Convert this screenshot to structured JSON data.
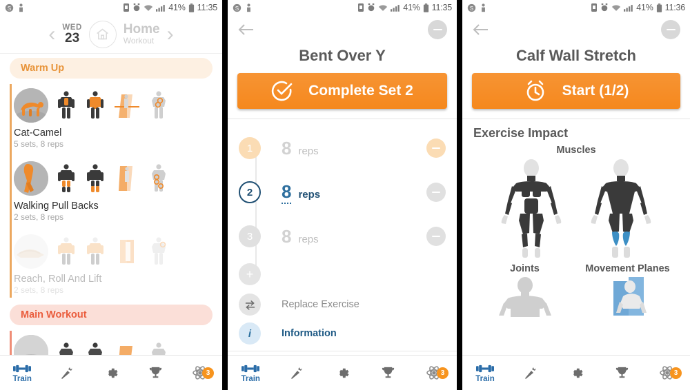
{
  "status_bar": {
    "left_icons": [
      "currency-circle-icon",
      "person-pin-icon"
    ],
    "right_icons": [
      "sim-card-icon",
      "alarm-icon",
      "wifi-icon",
      "signal-icon",
      "battery-icon"
    ],
    "battery_1": "41%",
    "time_1": "11:35",
    "battery_2": "41%",
    "time_2": "11:35",
    "battery_3": "41%",
    "time_3": "11:36"
  },
  "colors": {
    "accent_orange": "#f5881d",
    "warm_pill_bg": "#fdf0e2",
    "warm_pill_text": "#e8943a",
    "main_pill_bg": "#fbdfd8",
    "main_pill_text": "#ea5c3c",
    "active_blue": "#1f4f73",
    "nav_active": "#2a6ca8",
    "muscle_highlight_blue": "#3d8fc4",
    "badge_orange": "#f7941e"
  },
  "panel1": {
    "day_header": {
      "prev_label": "‹",
      "next_label": "›",
      "day_of_week": "WED",
      "day_number": "23",
      "home_icon": "home-icon",
      "plan_title": "Home",
      "plan_subtitle": "Workout"
    },
    "sections": [
      {
        "title": "Warm Up",
        "style": "warm",
        "exercises": [
          {
            "name": "Cat-Camel",
            "meta": "5 sets, 8 reps",
            "faded": false
          },
          {
            "name": "Walking Pull Backs",
            "meta": "2 sets, 8 reps",
            "faded": false
          },
          {
            "name": "Reach, Roll And Lift",
            "meta": "2 sets, 8 reps",
            "faded": true
          }
        ]
      },
      {
        "title": "Main Workout",
        "style": "main",
        "exercises": []
      }
    ]
  },
  "panel2": {
    "back_icon": "back-arrow-icon",
    "collapse_icon": "minus-circle-icon",
    "title": "Bent Over Y",
    "cta": {
      "icon": "check-circle-icon",
      "label": "Complete Set 2"
    },
    "sets": [
      {
        "index": "1",
        "value": "8",
        "unit": "reps",
        "state": "done"
      },
      {
        "index": "2",
        "value": "8",
        "unit": "reps",
        "state": "active"
      },
      {
        "index": "3",
        "value": "8",
        "unit": "reps",
        "state": "pending"
      }
    ],
    "add_set_label": "+",
    "actions": [
      {
        "icon": "swap-arrows-icon",
        "label": "Replace Exercise",
        "style": "gray"
      },
      {
        "icon": "info-icon",
        "label": "Information",
        "style": "blue"
      }
    ]
  },
  "panel3": {
    "back_icon": "back-arrow-icon",
    "collapse_icon": "minus-circle-icon",
    "title": "Calf Wall Stretch",
    "cta": {
      "icon": "alarm-clock-icon",
      "label": "Start (1/2)"
    },
    "impact_title": "Exercise Impact",
    "muscles_label": "Muscles",
    "joints_label": "Joints",
    "planes_label": "Movement Planes"
  },
  "bottom_nav": {
    "items": [
      {
        "icon": "dumbbell-icon",
        "label": "Train",
        "active": true,
        "badge": ""
      },
      {
        "icon": "carrot-icon",
        "label": "",
        "active": false,
        "badge": ""
      },
      {
        "icon": "gear-icon",
        "label": "",
        "active": false,
        "badge": ""
      },
      {
        "icon": "trophy-icon",
        "label": "",
        "active": false,
        "badge": ""
      },
      {
        "icon": "atom-icon",
        "label": "",
        "active": false,
        "badge": "3"
      }
    ]
  }
}
